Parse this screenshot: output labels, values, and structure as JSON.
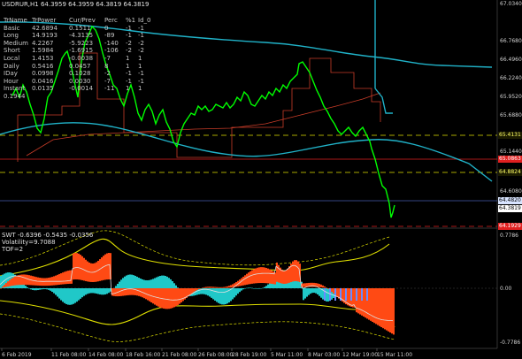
{
  "header": {
    "title": "USDRUR,H1 64.3959 64.3959 64.3819 64.3819"
  },
  "table": {
    "headers": [
      "TrName",
      "TrPower",
      "Cur/Prev",
      "Perc",
      "%1",
      "Id_0"
    ],
    "rows": [
      [
        "Basic",
        "42.6894",
        "0.1511",
        "0",
        "-1",
        "-1"
      ],
      [
        "Long",
        "14.9193",
        "-4.3135",
        "-89",
        "-1",
        "-1"
      ],
      [
        "Medium",
        "4.2267",
        "-5.9223",
        "-140",
        "-2",
        "-2"
      ],
      [
        "Short",
        "1.5984",
        "-1.6915",
        "-106",
        "-2",
        "-2"
      ],
      [
        "Local",
        "1.4153",
        "-0.0038",
        "-7",
        "1",
        "1"
      ],
      [
        "Daily",
        "0.5416",
        "0.0457",
        "8",
        "1",
        "1"
      ],
      [
        "IDay",
        "0.0998",
        "0.1028",
        "-2",
        "-1",
        "-1"
      ],
      [
        "Hour",
        "0.0416",
        "0.0030",
        "-7",
        "-1",
        "-1"
      ],
      [
        "Instant",
        "0.0135",
        "-0.0014",
        "-11",
        "1",
        "1"
      ]
    ],
    "extra": "0.1944"
  },
  "price_axis": [
    "67.0340",
    "66.7680",
    "66.4960",
    "66.2240",
    "65.9520",
    "65.6880",
    "65.1440",
    "64.6080",
    "64.3360"
  ],
  "tags": [
    {
      "text": "65.4131",
      "bg": "#1a1a00",
      "fg": "#ffff66"
    },
    {
      "text": "65.0863",
      "bg": "#e02020",
      "fg": "#ffffff"
    },
    {
      "text": "64.8824",
      "bg": "#1a1a00",
      "fg": "#ffff66"
    },
    {
      "text": "64.4820",
      "bg": "#d8e4ff",
      "fg": "#000000"
    },
    {
      "text": "64.3819",
      "bg": "#ffffff",
      "fg": "#000000"
    },
    {
      "text": "64.1929",
      "bg": "#e02020",
      "fg": "#ffffff"
    }
  ],
  "sub_title": "SWT -0.6396 -0.5435 -0.0356",
  "sub_vol": "Volatility=9.7088",
  "sub_tof": "TOF=2",
  "sub_axis": [
    "0.7786",
    "0.00",
    "-0.7786"
  ],
  "time_axis": [
    "6 Feb 2019",
    "11 Feb 08:00",
    "14 Feb 08:00",
    "18 Feb 16:00",
    "21 Feb 08:00",
    "26 Feb 08:00",
    "28 Feb 19:00",
    "5 Mar 11:00",
    "8 Mar 03:00",
    "12 Mar 19:00",
    "15 Mar 11:00"
  ],
  "colors": {
    "candle": "#00ff00",
    "ma": "#20b2c8",
    "zigzag": "#c83c28",
    "ref": "#e0e000",
    "osc_pos": "#ff4a14",
    "osc_neg": "#20c8c8",
    "osc_blue": "#6a8aff",
    "osc_white": "#e0e0e0"
  }
}
